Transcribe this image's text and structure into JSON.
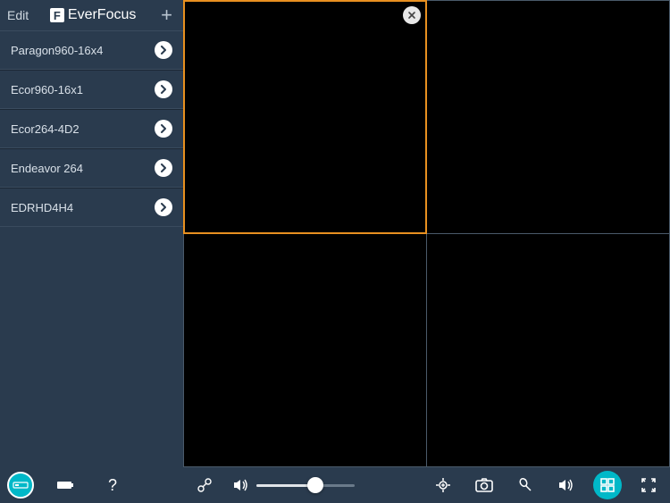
{
  "header": {
    "edit_label": "Edit",
    "brand_name": "EverFocus",
    "brand_mark": "F"
  },
  "devices": [
    {
      "label": "Paragon960-16x4"
    },
    {
      "label": "Ecor960-16x1"
    },
    {
      "label": "Ecor264-4D2"
    },
    {
      "label": "Endeavor 264"
    },
    {
      "label": "EDRHD4H4"
    }
  ],
  "grid": {
    "panels": 4,
    "selected_index": 0
  },
  "controls": {
    "volume_level": 60
  }
}
